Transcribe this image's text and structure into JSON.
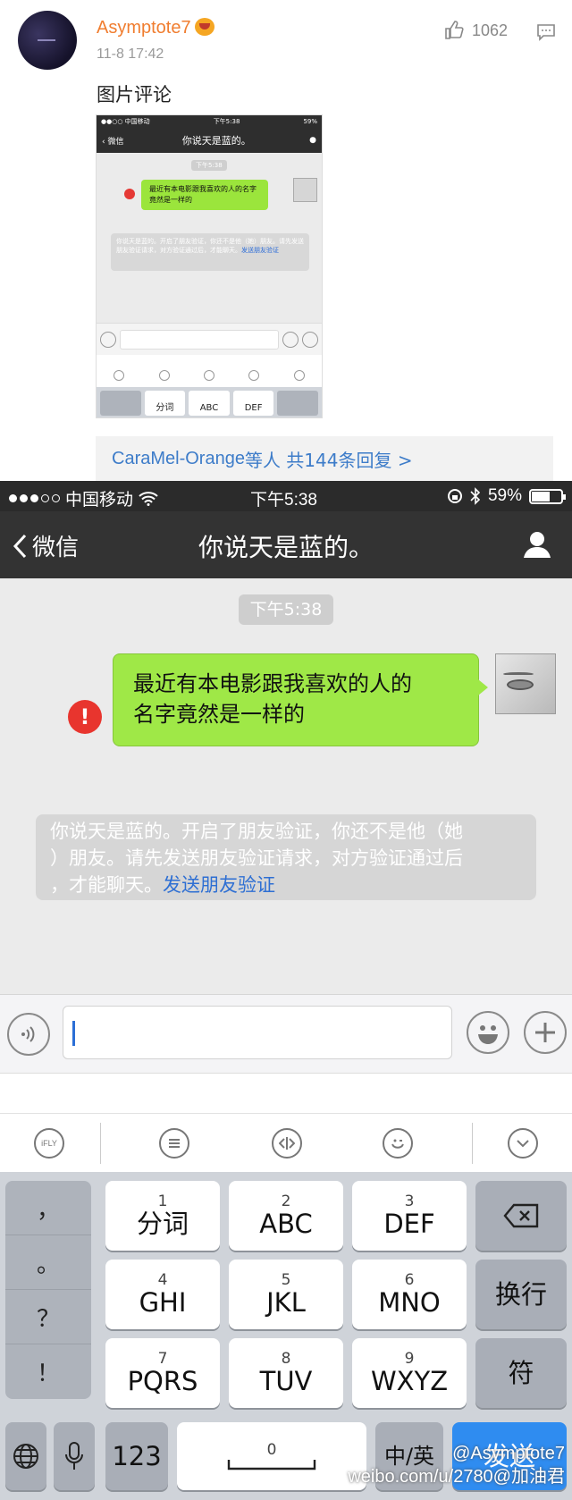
{
  "post": {
    "username": "Asymptote7",
    "time": "11-8 17:42",
    "like_count": "1062",
    "text": "图片评论",
    "replies_prefix": "CaraMel-Orange",
    "replies_suffix": "等人 共144条回复 >"
  },
  "thumb": {
    "carrier": "●●○○ 中国移动",
    "time": "下午5:38",
    "battery": "59%",
    "back": "微信",
    "title": "你说天是蓝的。",
    "ts": "下午5:38",
    "message": "最近有本电影跟我喜欢的人的名字竟然是一样的",
    "notice": "你说天是蓝的。开启了朋友验证，你还不是他（她）朋友。请先发送朋友验证请求，对方验证通过后，才能聊天。",
    "notice_link": "发送朋友验证",
    "keys": [
      "分词",
      "ABC",
      "DEF"
    ]
  },
  "status_bar": {
    "carrier": "中国移动",
    "time": "下午5:38",
    "battery": "59%"
  },
  "navbar": {
    "back_label": "微信",
    "title": "你说天是蓝的。"
  },
  "chat": {
    "timestamp": "下午5:38",
    "message_line1": "最近有本电影跟我喜欢的人的",
    "message_line2": "名字竟然是一样的",
    "error_mark": "!",
    "notice_line1": "你说天是蓝的。开启了朋友验证，你还不是他（她",
    "notice_line2": "）朋友。请先发送朋友验证请求，对方验证通过后",
    "notice_line3": "，才能聊天。",
    "notice_link": "发送朋友验证"
  },
  "keyboard": {
    "toolbar_logo": "iFLY",
    "side_keys": [
      "，",
      "。",
      "？",
      "！"
    ],
    "keys": [
      {
        "num": "1",
        "label": "分词"
      },
      {
        "num": "2",
        "label": "ABC"
      },
      {
        "num": "3",
        "label": "DEF"
      },
      {
        "num": "4",
        "label": "GHI"
      },
      {
        "num": "5",
        "label": "JKL"
      },
      {
        "num": "6",
        "label": "MNO"
      },
      {
        "num": "7",
        "label": "PQRS"
      },
      {
        "num": "8",
        "label": "TUV"
      },
      {
        "num": "9",
        "label": "WXYZ"
      }
    ],
    "enter_label": "换行",
    "symbol_label": "符",
    "num_label": "123",
    "space_num": "0",
    "lang_label": "中/英",
    "send_label": "发送"
  },
  "watermark": {
    "line1": "@Asymptote7",
    "line2": "weibo.com/u/2780@加油君"
  },
  "colors": {
    "username": "#f07d2f",
    "link": "#3d7cc9",
    "bubble": "#9fe847",
    "send": "#2f8cf0",
    "error": "#e8352e"
  }
}
